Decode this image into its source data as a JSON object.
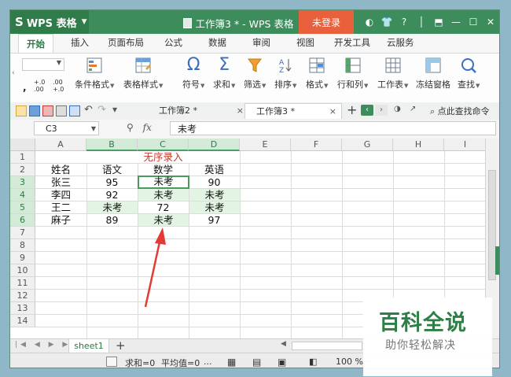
{
  "titlebar": {
    "app_name": "WPS 表格",
    "window_title": "工作簿3 * - WPS 表格",
    "login_label": "未登录",
    "question_icon": "?"
  },
  "menu_tabs": [
    "开始",
    "插入",
    "页面布局",
    "公式",
    "数据",
    "审阅",
    "视图",
    "开发工具",
    "云服务"
  ],
  "ribbon": {
    "buttons": [
      {
        "label": "条件格式",
        "icon": "conditional-format-icon"
      },
      {
        "label": "表格样式",
        "icon": "table-style-icon"
      },
      {
        "label": "符号",
        "icon": "omega-icon"
      },
      {
        "label": "求和",
        "icon": "sigma-icon"
      },
      {
        "label": "筛选",
        "icon": "filter-icon"
      },
      {
        "label": "排序",
        "icon": "sort-icon"
      },
      {
        "label": "格式",
        "icon": "format-icon"
      },
      {
        "label": "行和列",
        "icon": "row-col-icon"
      },
      {
        "label": "工作表",
        "icon": "worksheet-icon"
      },
      {
        "label": "冻结窗格",
        "icon": "freeze-icon"
      },
      {
        "label": "查找",
        "icon": "search-icon"
      }
    ],
    "decimal_more": "+.0 .00",
    "decimal_less": ".00 +.0",
    "comma": ","
  },
  "doc_tabs": [
    {
      "label": "工作簿2 *",
      "close": "×"
    },
    {
      "label": "工作簿3 *",
      "close": "×"
    }
  ],
  "doc_search_label": "点此查找命令",
  "formula_bar": {
    "name_box": "C3",
    "fx": "fx",
    "value": "未考"
  },
  "columns": [
    "A",
    "B",
    "C",
    "D",
    "E",
    "F",
    "G",
    "H",
    "I"
  ],
  "rows": [
    "1",
    "2",
    "3",
    "4",
    "5",
    "6",
    "7",
    "8",
    "9",
    "10",
    "11",
    "12",
    "13",
    "14"
  ],
  "table": {
    "title": "无序录入",
    "headers": [
      "姓名",
      "语文",
      "数学",
      "英语"
    ],
    "data": [
      [
        "张三",
        "95",
        "未考",
        "90"
      ],
      [
        "李四",
        "92",
        "未考",
        "未考"
      ],
      [
        "王二",
        "未考",
        "72",
        "未考"
      ],
      [
        "麻子",
        "89",
        "未考",
        "97"
      ]
    ]
  },
  "sheet_tabs": [
    "sheet1"
  ],
  "add_sheet": "+",
  "statusbar": {
    "sum": "求和=0",
    "avg": "平均值=0",
    "dots": "...",
    "zoom": "100 %",
    "minus": "−"
  },
  "watermark": {
    "brand": "百科全说",
    "slogan": "助你轻松解决"
  },
  "colors": {
    "accent": "#3d8c5c",
    "login": "#e8603c",
    "highlight": "#e3f4e4",
    "title_red": "#c0392b",
    "arrow_red": "#e53935"
  }
}
